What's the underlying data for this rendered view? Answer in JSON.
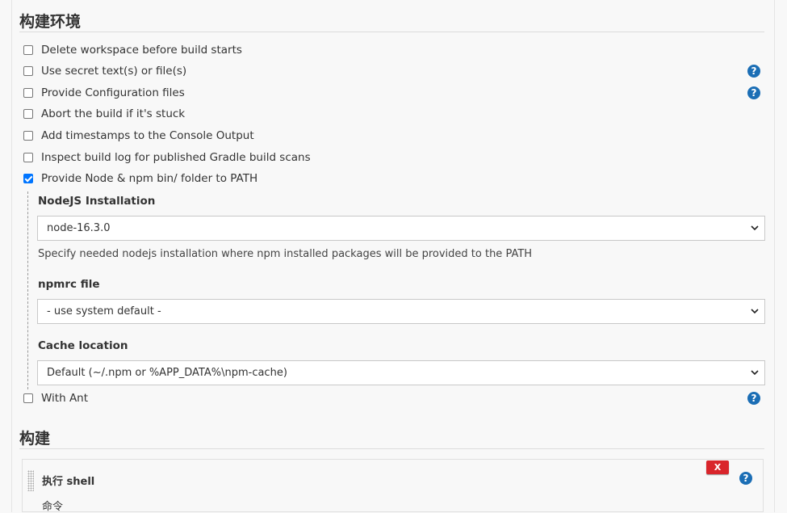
{
  "sections": {
    "env_title": "构建环境",
    "build_title": "构建"
  },
  "env_options": [
    {
      "label": "Delete workspace before build starts",
      "checked": false,
      "help": false
    },
    {
      "label": "Use secret text(s) or file(s)",
      "checked": false,
      "help": true
    },
    {
      "label": "Provide Configuration files",
      "checked": false,
      "help": true
    },
    {
      "label": "Abort the build if it's stuck",
      "checked": false,
      "help": false
    },
    {
      "label": "Add timestamps to the Console Output",
      "checked": false,
      "help": false
    },
    {
      "label": "Inspect build log for published Gradle build scans",
      "checked": false,
      "help": false
    },
    {
      "label": "Provide Node & npm bin/ folder to PATH",
      "checked": true,
      "help": false
    }
  ],
  "node": {
    "installation_label": "NodeJS Installation",
    "installation_value": "node-16.3.0",
    "installation_desc": "Specify needed nodejs installation where npm installed packages will be provided to the PATH",
    "npmrc_label": "npmrc file",
    "npmrc_value": "- use system default -",
    "cache_label": "Cache location",
    "cache_value": "Default (~/.npm or %APP_DATA%\\npm-cache)"
  },
  "with_ant": {
    "label": "With Ant",
    "checked": false
  },
  "help_glyph": "?",
  "build_step": {
    "title": "执行 shell",
    "command_label": "命令",
    "delete_label": "X"
  }
}
